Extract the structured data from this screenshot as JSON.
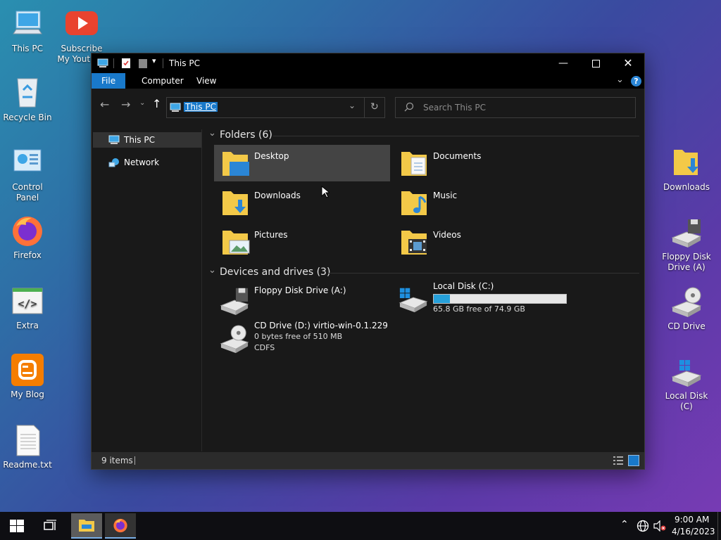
{
  "desktop": {
    "left_icons": [
      {
        "label": "This PC"
      },
      {
        "label": "Subscribe My Youtube"
      },
      {
        "label": "Recycle Bin"
      },
      {
        "label": "Control Panel"
      },
      {
        "label": "Firefox"
      },
      {
        "label": "Extra"
      },
      {
        "label": "My Blog"
      },
      {
        "label": "Readme.txt"
      }
    ],
    "right_icons": [
      {
        "label": "Downloads"
      },
      {
        "label": "Floppy Disk Drive (A)"
      },
      {
        "label": "CD Drive"
      },
      {
        "label": "Local Disk (C)"
      }
    ]
  },
  "window": {
    "title": "This PC",
    "ribbon_tabs": [
      "File",
      "Computer",
      "View"
    ],
    "address": "This PC",
    "search_placeholder": "Search This PC",
    "nav_items": [
      {
        "label": "This PC",
        "icon": "pc-icon"
      },
      {
        "label": "Network",
        "icon": "network-icon"
      }
    ],
    "folders_header": "Folders (6)",
    "folders": [
      {
        "name": "Desktop",
        "icon": "desktop-folder-icon"
      },
      {
        "name": "Documents",
        "icon": "documents-folder-icon"
      },
      {
        "name": "Downloads",
        "icon": "downloads-folder-icon"
      },
      {
        "name": "Music",
        "icon": "music-folder-icon"
      },
      {
        "name": "Pictures",
        "icon": "pictures-folder-icon"
      },
      {
        "name": "Videos",
        "icon": "videos-folder-icon"
      }
    ],
    "drives_header": "Devices and drives (3)",
    "drives": [
      {
        "name": "Floppy Disk Drive (A:)",
        "icon": "floppy-drive-icon"
      },
      {
        "name": "Local Disk (C:)",
        "detail": "65.8 GB free of 74.9 GB",
        "used_fraction": 0.12,
        "icon": "local-disk-icon"
      },
      {
        "name": "CD Drive (D:) virtio-win-0.1.229",
        "detail": "0 bytes free of 510 MB",
        "fs": "CDFS",
        "icon": "cd-drive-icon"
      }
    ],
    "status": "9 items"
  },
  "taskbar": {
    "time": "9:00 AM",
    "date": "4/16/2023"
  },
  "colors": {
    "accent": "#1979ca",
    "drive_bar": "#26a0da",
    "folder": "#f3c948"
  }
}
